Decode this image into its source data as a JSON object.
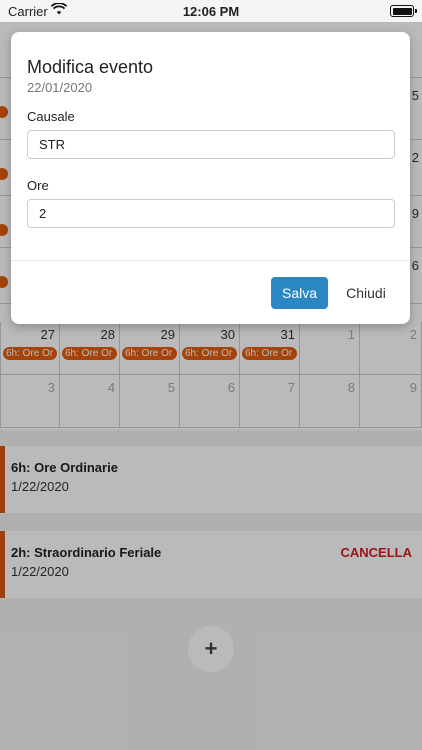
{
  "status_bar": {
    "carrier": "Carrier",
    "time": "12:06 PM"
  },
  "calendar": {
    "edge_numbers": [
      "5",
      "2",
      "9",
      "6"
    ],
    "week_5": {
      "days": [
        "27",
        "28",
        "29",
        "30",
        "31",
        "1",
        "2"
      ],
      "event_label": "6h: Ore Or"
    },
    "week_6": {
      "days": [
        "3",
        "4",
        "5",
        "6",
        "7",
        "8",
        "9"
      ]
    }
  },
  "events": [
    {
      "title": "6h: Ore Ordinarie",
      "date": "1/22/2020"
    },
    {
      "title": "2h: Straordinario Feriale",
      "date": "1/22/2020",
      "cancel_label": "CANCELLA"
    }
  ],
  "fab": {
    "label": "+"
  },
  "modal": {
    "title": "Modifica evento",
    "subtitle": "22/01/2020",
    "field_causale": {
      "label": "Causale",
      "value": "STR"
    },
    "field_ore": {
      "label": "Ore",
      "value": "2"
    },
    "save_label": "Salva",
    "close_label": "Chiudi"
  },
  "colors": {
    "event_accent": "#e35d0e",
    "primary_button": "#2a87c4",
    "cancel_text": "#d21f1f"
  }
}
